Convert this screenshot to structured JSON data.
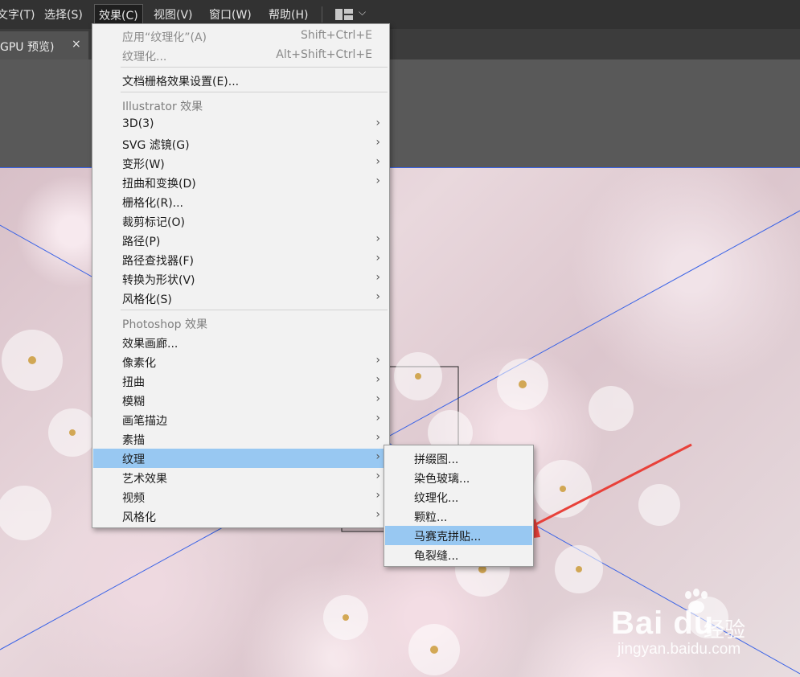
{
  "menubar": {
    "items": [
      "文字(T)",
      "选择(S)",
      "效果(C)",
      "视图(V)",
      "窗口(W)",
      "帮助(H)"
    ],
    "workspace_icon": "workspace-switcher-icon",
    "workspace_chevron": "chevron-down-icon"
  },
  "tab": {
    "title": "GPU 预览)",
    "close": "×"
  },
  "effects_menu": {
    "apply_last": {
      "label": "应用“纹理化”(A)",
      "shortcut": "Shift+Ctrl+E"
    },
    "last_effect": {
      "label": "纹理化...",
      "shortcut": "Alt+Shift+Ctrl+E"
    },
    "raster_settings": "文档栅格效果设置(E)...",
    "illustrator_header": "Illustrator 效果",
    "illustrator_items": [
      "3D(3)",
      "SVG 滤镜(G)",
      "变形(W)",
      "扭曲和变换(D)",
      "栅格化(R)...",
      "裁剪标记(O)",
      "路径(P)",
      "路径查找器(F)",
      "转换为形状(V)",
      "风格化(S)"
    ],
    "photoshop_header": "Photoshop 效果",
    "photoshop_items": [
      "效果画廊...",
      "像素化",
      "扭曲",
      "模糊",
      "画笔描边",
      "素描",
      "纹理",
      "艺术效果",
      "视频",
      "风格化"
    ]
  },
  "texture_submenu": {
    "items": [
      "拼缀图...",
      "染色玻璃...",
      "纹理化...",
      "颗粒...",
      "马赛克拼贴...",
      "龟裂缝..."
    ],
    "highlighted": "马赛克拼贴..."
  },
  "watermark": {
    "logo": "Bai du",
    "sub": "经验",
    "url": "jingyan.baidu.com"
  },
  "colors": {
    "highlight": "#98c8f2",
    "guide": "#3a63e6",
    "arrow": "#e8413a",
    "menubar_bg": "#323232"
  }
}
